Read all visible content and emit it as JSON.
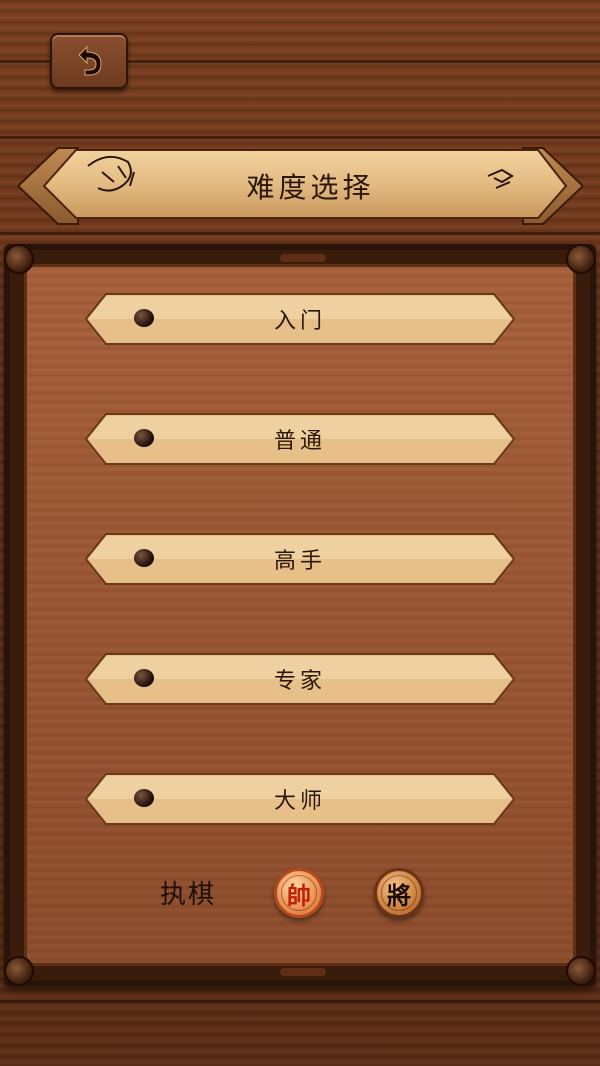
{
  "header": {
    "back_icon": "undo-arrow-icon",
    "title": "难度选择"
  },
  "difficulty": {
    "levels": [
      {
        "label": "入门"
      },
      {
        "label": "普通"
      },
      {
        "label": "高手"
      },
      {
        "label": "专家"
      },
      {
        "label": "大师"
      }
    ]
  },
  "side_select": {
    "label": "执棋",
    "red_piece": "帥",
    "black_piece": "將"
  },
  "colors": {
    "wood_dark": "#5b2c14",
    "panel_wood": "#9a5532",
    "plank_light": "#e6c088",
    "text_dark": "#2b1608",
    "red_piece_text": "#c0200c"
  }
}
